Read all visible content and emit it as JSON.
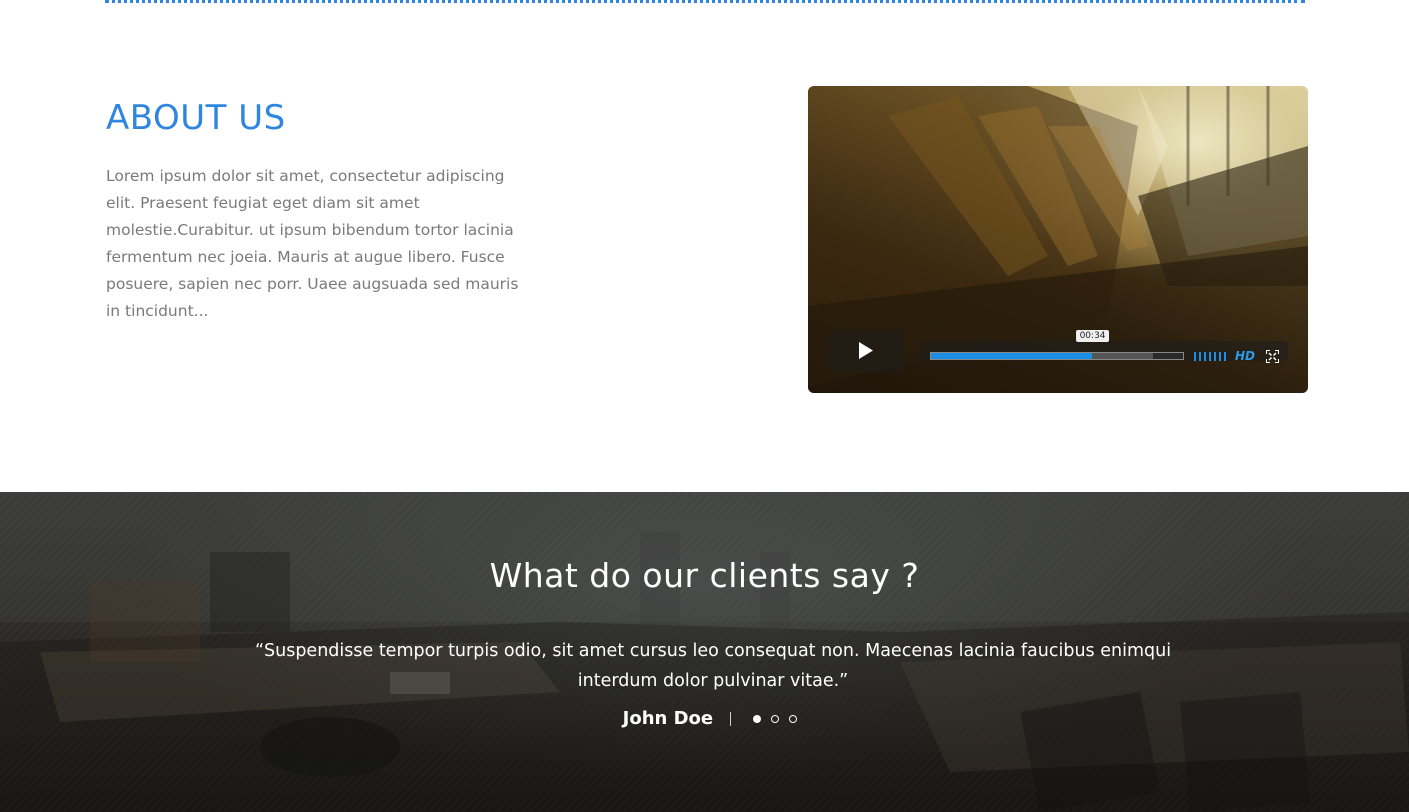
{
  "about": {
    "heading": "ABOUT US",
    "body": "Lorem ipsum dolor sit amet, consectetur adipiscing elit. Praesent feugiat eget diam sit amet molestie.Curabitur. ut ipsum bibendum tortor lacinia fermentum nec joeia. Mauris at augue libero. Fusce posuere, sapien nec porr. Uaee augsuada sed mauris in tincidunt..."
  },
  "video": {
    "time_tooltip": "00:34",
    "progress_percent": 64,
    "loaded_percent": 88,
    "hd_label": "HD",
    "icons": [
      "play-icon",
      "volume-icon",
      "fullscreen-icon"
    ]
  },
  "testimonials": {
    "heading": "What do our clients say ?",
    "quote": "“Suspendisse tempor turpis odio, sit amet cursus leo consequat non. Maecenas lacinia faucibus enimqui interdum dolor pulvinar vitae.”",
    "author": "John Doe",
    "slides": 3,
    "active_slide": 0
  },
  "colors": {
    "accent": "#2e86de",
    "progress": "#1a8fe3",
    "body_text": "#7a7a7a"
  }
}
